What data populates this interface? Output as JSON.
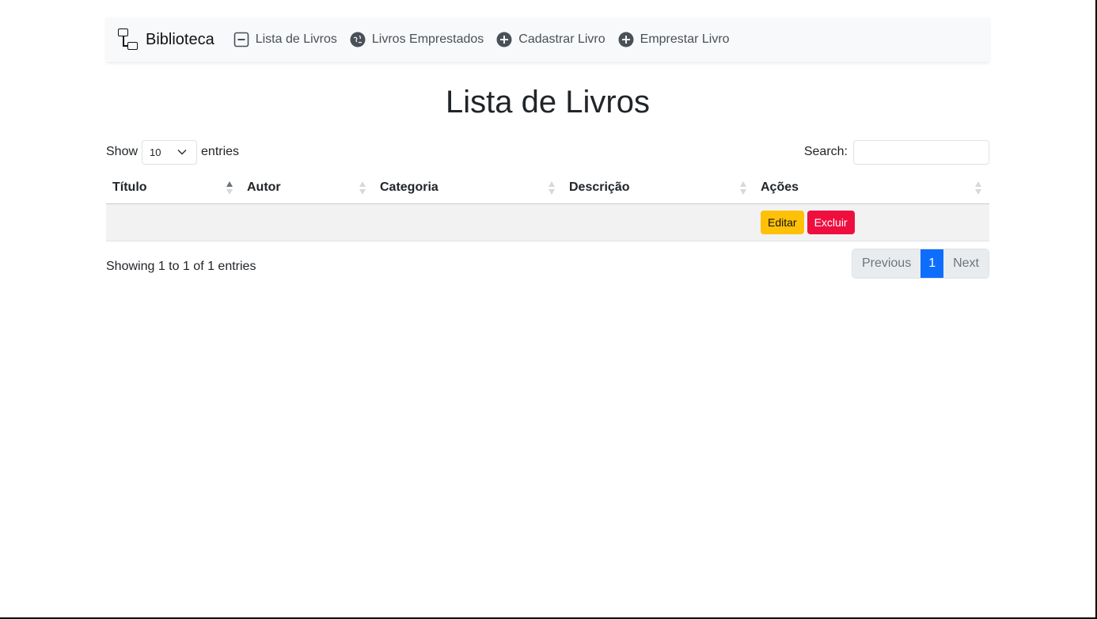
{
  "navbar": {
    "brand": "Biblioteca",
    "items": [
      {
        "label": "Lista de Livros",
        "icon": "dash-square-icon"
      },
      {
        "label": "Livros Emprestados",
        "icon": "globe-icon"
      },
      {
        "label": "Cadastrar Livro",
        "icon": "plus-circle-icon"
      },
      {
        "label": "Emprestar Livro",
        "icon": "plus-circle-icon"
      }
    ]
  },
  "page": {
    "title": "Lista de Livros"
  },
  "controls": {
    "show_label": "Show",
    "entries_value": "10",
    "entries_label": "entries",
    "search_label": "Search:",
    "search_value": ""
  },
  "table": {
    "headers": [
      "Título",
      "Autor",
      "Categoria",
      "Descrição",
      "Ações"
    ],
    "sorted_column": "Título",
    "rows": [
      {
        "titulo": "",
        "autor": "",
        "categoria": "",
        "descricao": "",
        "edit_label": "Editar",
        "delete_label": "Excluir"
      }
    ]
  },
  "info": "Showing 1 to 1 of 1 entries",
  "pagination": {
    "previous": "Previous",
    "current": "1",
    "next": "Next"
  },
  "colors": {
    "edit_button": "#ffc107",
    "delete_button": "#ef0f3f",
    "active_page": "#0d6efd",
    "navbar_bg": "#f8f9fa"
  }
}
